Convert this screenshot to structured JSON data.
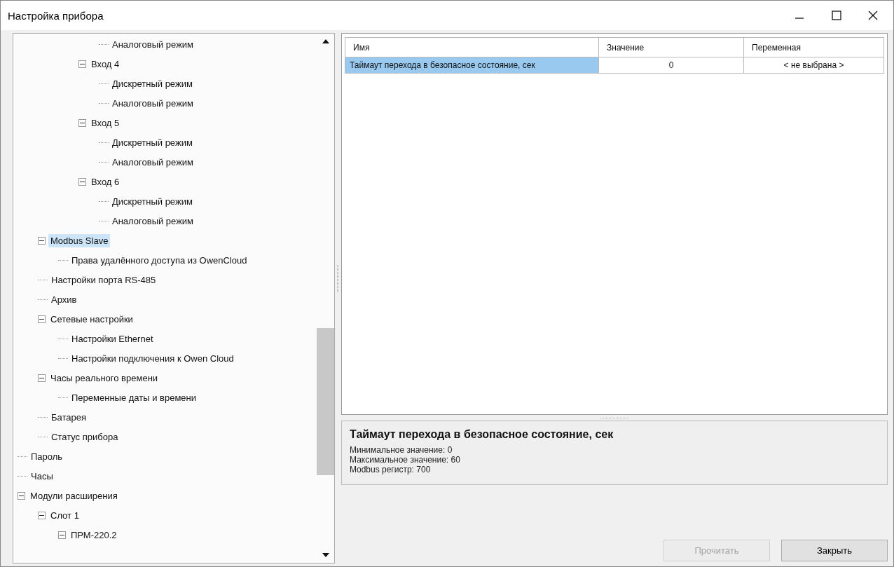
{
  "window": {
    "title": "Настройка прибора"
  },
  "tree": {
    "items": [
      {
        "children": [
          {
            "children": [
              {
                "children": [
                  {
                    "children": [
                      {
                        "label": "Аналоговый режим",
                        "selected": false
                      }
                    ]
                  },
                  {
                    "label": "Вход 4",
                    "expanded": true,
                    "selected": false,
                    "children": [
                      {
                        "label": "Дискретный режим",
                        "selected": false
                      },
                      {
                        "label": "Аналоговый режим",
                        "selected": false
                      }
                    ]
                  },
                  {
                    "label": "Вход 5",
                    "expanded": true,
                    "selected": false,
                    "children": [
                      {
                        "label": "Дискретный режим",
                        "selected": false
                      },
                      {
                        "label": "Аналоговый режим",
                        "selected": false
                      }
                    ]
                  },
                  {
                    "label": "Вход 6",
                    "expanded": true,
                    "selected": false,
                    "children": [
                      {
                        "label": "Дискретный режим",
                        "selected": false
                      },
                      {
                        "label": "Аналоговый режим",
                        "selected": false
                      }
                    ]
                  }
                ]
              }
            ]
          },
          {
            "label": "Modbus Slave",
            "expanded": true,
            "selected": true,
            "children": [
              {
                "label": "Права удалённого доступа из OwenCloud",
                "selected": false
              }
            ]
          },
          {
            "label": "Настройки порта RS-485",
            "selected": false
          },
          {
            "label": "Архив",
            "selected": false
          },
          {
            "label": "Сетевые настройки",
            "expanded": true,
            "selected": false,
            "children": [
              {
                "label": "Настройки Ethernet",
                "selected": false
              },
              {
                "label": "Настройки подключения к Owen Cloud",
                "selected": false
              }
            ]
          },
          {
            "label": "Часы реального времени",
            "expanded": true,
            "selected": false,
            "children": [
              {
                "label": "Переменные даты и времени",
                "selected": false
              }
            ]
          },
          {
            "label": "Батарея",
            "selected": false
          },
          {
            "label": "Статус прибора",
            "selected": false
          }
        ]
      },
      {
        "label": "Пароль",
        "selected": false
      },
      {
        "label": "Часы",
        "selected": false
      },
      {
        "label": "Модули расширения",
        "expanded": true,
        "selected": false,
        "children": [
          {
            "label": "Слот 1",
            "expanded": true,
            "selected": false,
            "children": [
              {
                "label": "ПРМ-220.2",
                "expanded": true,
                "selected": false
              }
            ]
          }
        ]
      }
    ]
  },
  "table": {
    "columns": [
      "Имя",
      "Значение",
      "Переменная"
    ],
    "rows": [
      {
        "name": "Таймаут перехода в безопасное состояние, сек",
        "value": "0",
        "variable": "< не выбрана >",
        "selected": true
      }
    ]
  },
  "description": {
    "title": "Таймаут перехода в безопасное состояние, сек",
    "lines": [
      "Минимальное значение: 0",
      "Максимальное значение: 60",
      "Modbus регистр: 700"
    ]
  },
  "buttons": [
    {
      "label": "Прочитать",
      "disabled": true
    },
    {
      "label": "Закрыть",
      "disabled": false
    }
  ]
}
